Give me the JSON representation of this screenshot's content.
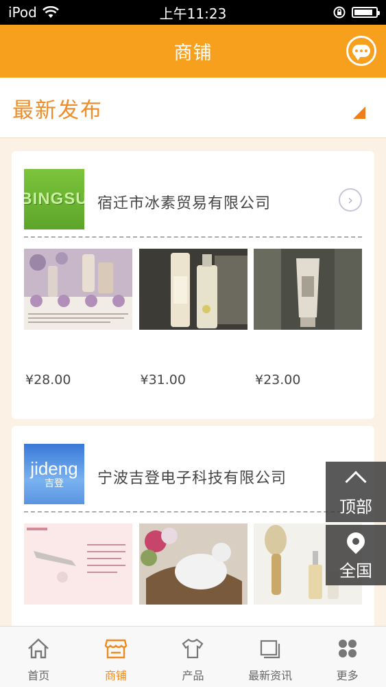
{
  "status_bar": {
    "carrier": "iPod",
    "time": "上午11:23",
    "battery_level": 0.85
  },
  "header": {
    "title": "商铺",
    "chat_icon": "chat-bubble-icon"
  },
  "section": {
    "title": "最新发布"
  },
  "stores": [
    {
      "name": "宿迁市冰素贸易有限公司",
      "logo_text": "BINGSU",
      "products": [
        {
          "price": "¥28.00"
        },
        {
          "price": "¥31.00"
        },
        {
          "price": "¥23.00"
        }
      ]
    },
    {
      "name": "宁波吉登电子科技有限公司",
      "logo_text_en": "jideng",
      "logo_text_cn": "吉登",
      "products": [
        {
          "price": ""
        },
        {
          "price": ""
        },
        {
          "price": ""
        }
      ]
    }
  ],
  "float_buttons": {
    "top_label": "顶部",
    "nation_label": "全国"
  },
  "tabbar": {
    "items": [
      {
        "label": "首页",
        "icon": "home-icon"
      },
      {
        "label": "商铺",
        "icon": "shop-icon"
      },
      {
        "label": "产品",
        "icon": "shirt-icon"
      },
      {
        "label": "最新资讯",
        "icon": "news-icon"
      },
      {
        "label": "更多",
        "icon": "more-icon"
      }
    ],
    "active_index": 1
  },
  "colors": {
    "accent": "#f6a01e",
    "accent_text": "#ef8d2a",
    "background": "#fbf1e4"
  }
}
